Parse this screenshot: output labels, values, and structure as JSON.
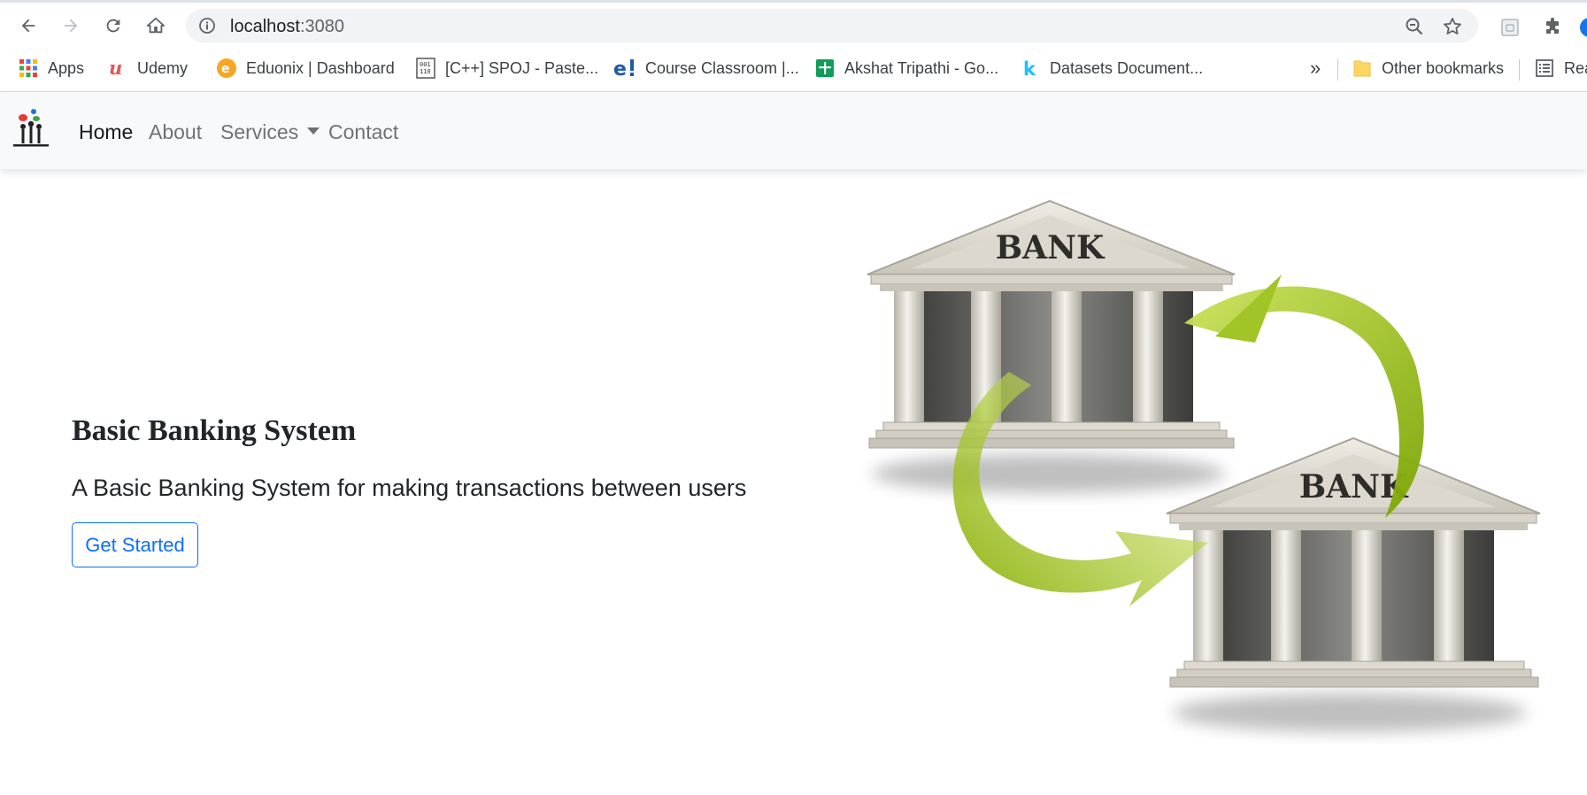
{
  "browser": {
    "url_host": "localhost",
    "url_port": ":3080",
    "bookmarks": [
      {
        "label": "Apps",
        "icon": "apps-grid-icon"
      },
      {
        "label": "Udemy",
        "icon": "udemy-icon"
      },
      {
        "label": "Eduonix | Dashboard",
        "icon": "eduonix-icon"
      },
      {
        "label": "[C++] SPOJ - Paste...",
        "icon": "spoj-icon"
      },
      {
        "label": "Course Classroom |...",
        "icon": "eduonix-e-icon"
      },
      {
        "label": "Akshat Tripathi - Go...",
        "icon": "google-sheets-icon"
      },
      {
        "label": "Datasets Document...",
        "icon": "kaggle-icon"
      }
    ],
    "overflow_label": "»",
    "other_bookmarks": "Other bookmarks",
    "reading_list": "Rea"
  },
  "navbar": {
    "links": [
      "Home",
      "About",
      "Services",
      "Contact"
    ]
  },
  "hero": {
    "title": "Basic Banking System",
    "subtitle": "A Basic Banking System for making transactions between users",
    "cta_label": "Get Started",
    "image_text_top": "BANK",
    "image_text_bottom": "BANK"
  },
  "colors": {
    "navbar_bg": "#f8f9fa",
    "primary": "#0d6efd",
    "arrow_green": "#8fb800"
  }
}
